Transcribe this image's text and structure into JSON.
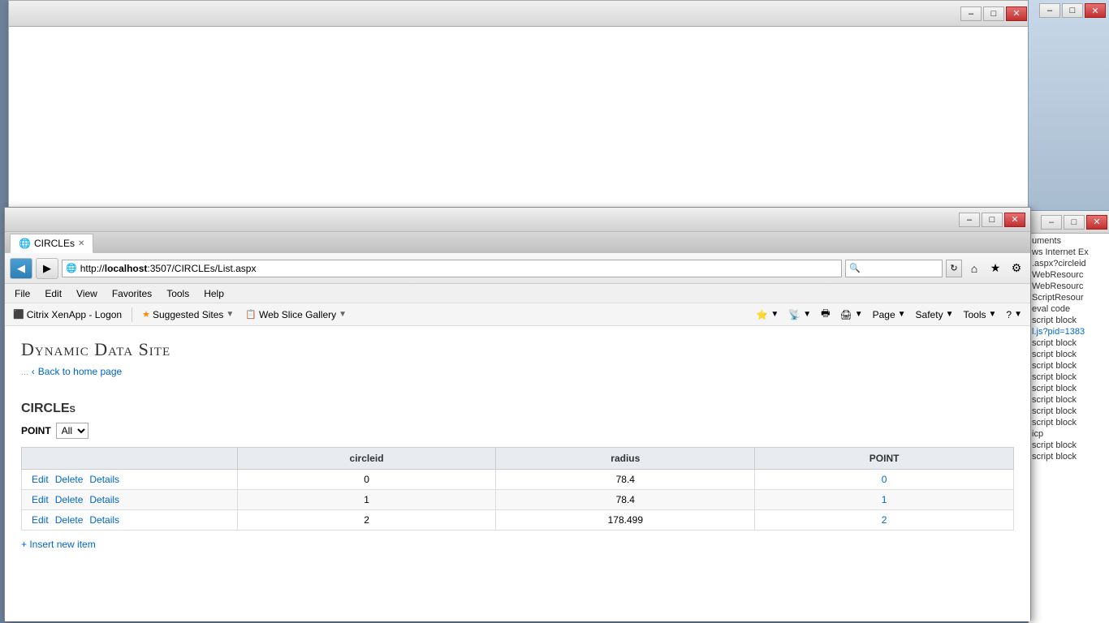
{
  "bg_browser": {
    "title": ""
  },
  "right_panel": {
    "items": [
      {
        "text": "uments",
        "type": "normal"
      },
      {
        "text": "ws Internet Ex",
        "type": "normal"
      },
      {
        "text": ".aspx?circleid",
        "type": "normal"
      },
      {
        "text": "WebResourc",
        "type": "normal"
      },
      {
        "text": "WebResourc",
        "type": "normal"
      },
      {
        "text": "ScriptResour",
        "type": "normal"
      },
      {
        "text": "eval code",
        "type": "normal"
      },
      {
        "text": "script block",
        "type": "normal"
      },
      {
        "text": "l.js?pid=1383",
        "type": "blue"
      },
      {
        "text": "script block",
        "type": "normal"
      },
      {
        "text": "script block",
        "type": "normal"
      },
      {
        "text": "script block",
        "type": "normal"
      },
      {
        "text": "script block",
        "type": "normal"
      },
      {
        "text": "script block",
        "type": "normal"
      },
      {
        "text": "script block",
        "type": "normal"
      },
      {
        "text": "script block",
        "type": "normal"
      },
      {
        "text": "script block",
        "type": "normal"
      },
      {
        "text": "icp",
        "type": "normal"
      },
      {
        "text": "script block",
        "type": "normal"
      },
      {
        "text": "script block",
        "type": "normal"
      }
    ]
  },
  "main_browser": {
    "tab_label": "CIRCLEs",
    "address": "http://localhost:3507/CIRCLEs/List.aspx",
    "address_host": "localhost",
    "address_path": ":3507/CIRCLEs/List.aspx"
  },
  "menubar": {
    "items": [
      "File",
      "Edit",
      "View",
      "Favorites",
      "Tools",
      "Help"
    ]
  },
  "favbar": {
    "citrix_label": "Citrix XenApp - Logon",
    "suggested_label": "Suggested Sites",
    "webslice_label": "Web Slice Gallery"
  },
  "toolbar_buttons": {
    "home": "⌂",
    "favorites": "★",
    "settings": "⚙",
    "help": "?"
  },
  "page": {
    "site_title": "Dynamic Data Site",
    "back_label": "Back to home page",
    "section_title": "CIRCLEs",
    "filter_label": "POINT",
    "filter_value": "All",
    "filter_options": [
      "All"
    ],
    "table": {
      "headers": [
        "circleid",
        "radius",
        "POINT"
      ],
      "rows": [
        {
          "circleid": "0",
          "radius": "78.4",
          "point": "0",
          "point_link": true
        },
        {
          "circleid": "1",
          "radius": "78.4",
          "point": "1",
          "point_link": true
        },
        {
          "circleid": "2",
          "radius": "178.499",
          "point": "2",
          "point_link": true
        }
      ]
    },
    "insert_label": "+ Insert new item",
    "actions": {
      "edit": "Edit",
      "delete": "Delete",
      "details": "Details"
    }
  }
}
